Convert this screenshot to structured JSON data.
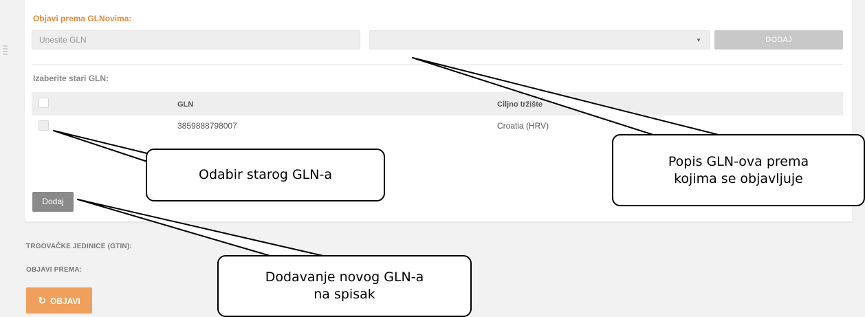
{
  "panel": {
    "title": "Objavi prema GLNovima:",
    "gln_input_placeholder": "Unesite GLN",
    "select_caret": "▼",
    "add_top_label": "DODAJ",
    "old_gln_label": "Izaberite stari GLN:",
    "table": {
      "headers": [
        "GLN",
        "Ciljno tržište"
      ],
      "rows": [
        {
          "gln": "3859888798007",
          "market": "Croatia (HRV)"
        }
      ]
    },
    "add_button_label": "Dodaj"
  },
  "sections": {
    "trade_units_label": "TRGOVAČKE JEDINICE (GTIN):",
    "publish_to_label": "OBJAVI PREMA:"
  },
  "publish_button": {
    "icon": "refresh-icon",
    "label": "OBJAVI"
  },
  "callouts": {
    "select_old": "Odabir starog GLN-a",
    "gln_list": "Popis GLN-ova prema\nkojima se objavljuje",
    "add_new": "Dodavanje novog GLN-a\nna spisak"
  },
  "colors": {
    "accent_orange": "#e08a3c",
    "publish_button": "#f0a05c",
    "disabled_button": "#c8c8c8",
    "add_button": "#8a8a8a"
  }
}
